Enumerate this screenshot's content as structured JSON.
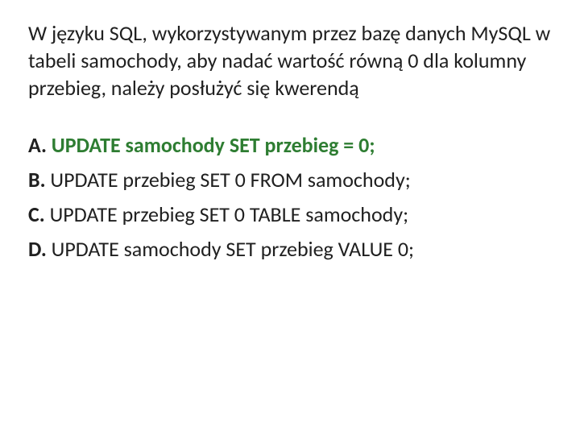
{
  "question": "W języku SQL, wykorzystywanym przez bazę danych MySQL w tabeli samochody, aby nadać wartość równą 0 dla kolumny przebieg, należy posłużyć się kwerendą",
  "options": {
    "a": {
      "label": "A.",
      "text": "UPDATE samochody SET przebieg = 0;",
      "correct": true
    },
    "b": {
      "label": "B.",
      "text": "UPDATE przebieg SET 0 FROM samochody;",
      "correct": false
    },
    "c": {
      "label": "C.",
      "text": "UPDATE przebieg SET 0 TABLE samochody;",
      "correct": false
    },
    "d": {
      "label": "D.",
      "text": "UPDATE samochody SET przebieg VALUE 0;",
      "correct": false
    }
  }
}
